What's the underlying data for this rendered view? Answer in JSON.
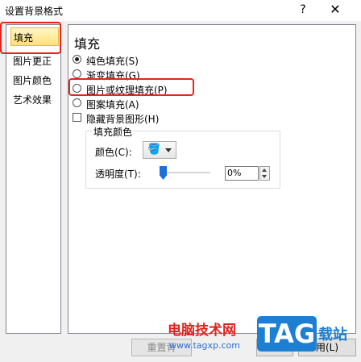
{
  "window": {
    "title": "设置背景格式",
    "help_glyph": "?",
    "close_glyph": "✕"
  },
  "sidebar": {
    "items": [
      {
        "label": "填充",
        "selected": true
      },
      {
        "label": "图片更正"
      },
      {
        "label": "图片颜色"
      },
      {
        "label": "艺术效果"
      }
    ]
  },
  "fill": {
    "heading": "填充",
    "options": [
      {
        "label": "纯色填充(S)",
        "checked": true
      },
      {
        "label": "渐变填充(G)"
      },
      {
        "label": "图片或纹理填充(P)"
      },
      {
        "label": "图案填充(A)"
      }
    ],
    "hide_bg_label": "隐藏背景图形(H)",
    "group_title": "填充颜色",
    "color_label": "颜色(C):",
    "transparency_label": "透明度(T):",
    "transparency_value": "0%",
    "transparency_fraction": 0
  },
  "buttons": {
    "reset": "重置背",
    "apply": "用(L)"
  },
  "watermark": {
    "text": "电脑技术网",
    "url": "www.tagxp.com",
    "logo": "TAG",
    "side": "载站"
  },
  "colors": {
    "highlight": "#e8241b",
    "selection": "#ffe07a",
    "accent": "#1e6fd9"
  },
  "icons": {
    "bucket": "paint-bucket-icon",
    "close": "close-icon",
    "help": "help-icon"
  }
}
